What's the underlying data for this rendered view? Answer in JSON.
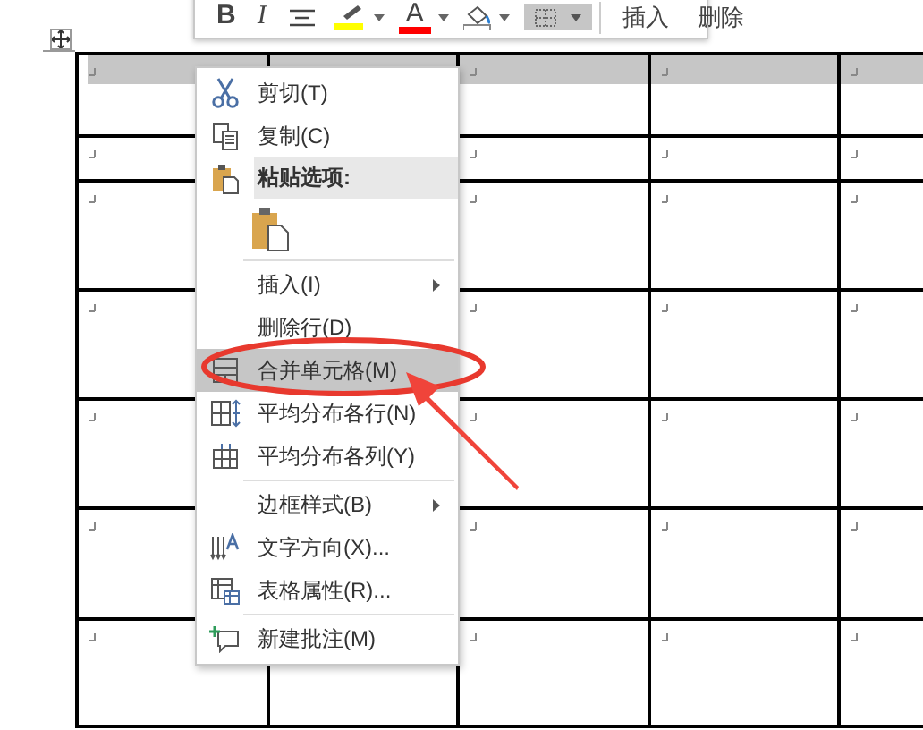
{
  "toolbar": {
    "buttons": [
      {
        "kind": "bold",
        "label": "B"
      },
      {
        "kind": "italic",
        "label": "I"
      },
      {
        "kind": "center"
      },
      {
        "kind": "highlight",
        "color": "#ffff00"
      },
      {
        "kind": "font-color",
        "label": "A",
        "color": "#ff0000"
      },
      {
        "kind": "shading"
      },
      {
        "kind": "borders"
      }
    ],
    "actions": [
      "插入",
      "删除"
    ]
  },
  "table": {
    "rows": [
      {
        "selected": true
      },
      {
        "selected": false
      },
      {
        "selected": false
      },
      {
        "selected": false
      },
      {
        "selected": false
      },
      {
        "selected": false
      },
      {
        "selected": false
      }
    ]
  },
  "context_menu": {
    "items": [
      {
        "kind": "command",
        "label": "剪切(T)",
        "selected": false,
        "submenu": false,
        "separator_before": false
      },
      {
        "kind": "command",
        "label": "复制(C)",
        "selected": false,
        "submenu": false,
        "separator_before": false
      },
      {
        "kind": "header",
        "label": "粘贴选项:"
      },
      {
        "kind": "paste"
      },
      {
        "kind": "command",
        "label": "插入(I)",
        "selected": false,
        "submenu": true,
        "separator_before": true
      },
      {
        "kind": "command",
        "label": "删除行(D)",
        "selected": false,
        "submenu": false,
        "separator_before": false
      },
      {
        "kind": "command",
        "label": "合并单元格(M)",
        "selected": true,
        "submenu": false,
        "separator_before": false
      },
      {
        "kind": "command",
        "label": "平均分布各行(N)",
        "selected": false,
        "submenu": false,
        "separator_before": false
      },
      {
        "kind": "command",
        "label": "平均分布各列(Y)",
        "selected": false,
        "submenu": false,
        "separator_before": false
      },
      {
        "kind": "command",
        "label": "边框样式(B)",
        "selected": false,
        "submenu": true,
        "separator_before": true
      },
      {
        "kind": "command",
        "label": "文字方向(X)...",
        "selected": false,
        "submenu": false,
        "separator_before": false
      },
      {
        "kind": "command",
        "label": "表格属性(R)...",
        "selected": false,
        "submenu": false,
        "separator_before": false
      },
      {
        "kind": "command",
        "label": "新建批注(M)",
        "selected": false,
        "submenu": false,
        "separator_before": true
      }
    ]
  }
}
